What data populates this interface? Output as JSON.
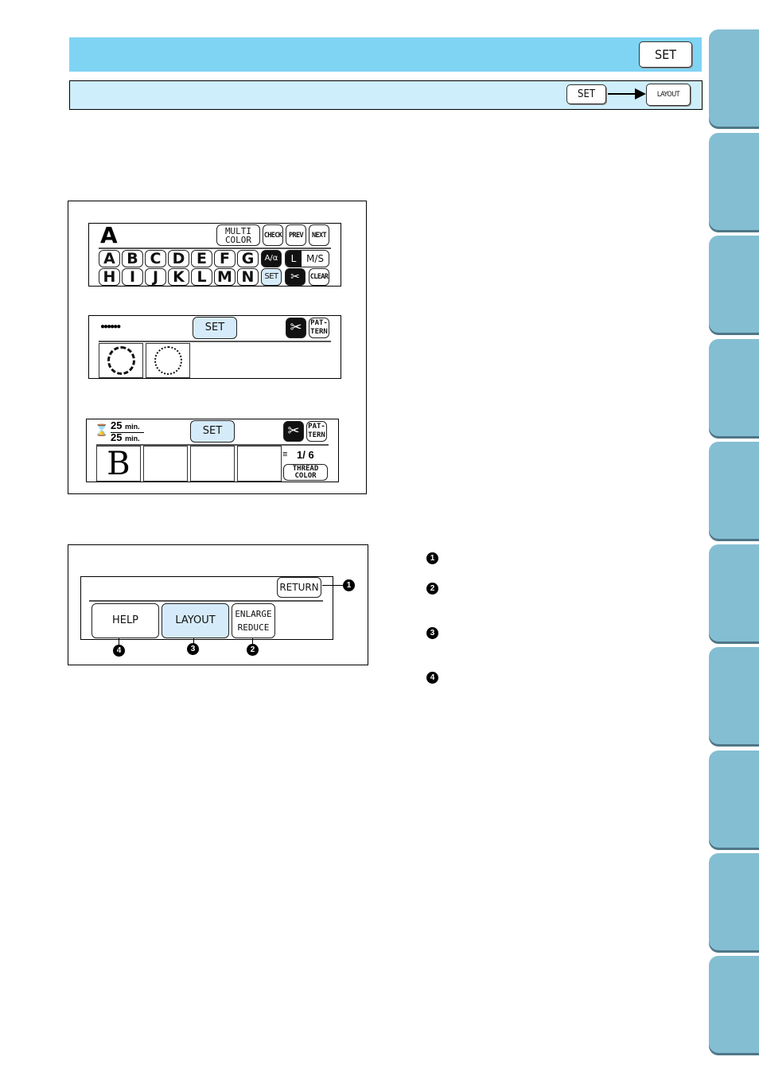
{
  "header": {
    "set_button": "SET"
  },
  "subheader": {
    "step1_button": "SET",
    "arrow_icon": "right-arrow-icon",
    "step2_button": "LAYOUT"
  },
  "figure1": {
    "screen1": {
      "selected_letter": "A",
      "multi_color": "MULTI\nCOLOR",
      "multi_color_line1": "MULTI",
      "multi_color_line2": "COLOR",
      "check": "CHECK",
      "prev": "PREV",
      "next": "NEXT",
      "letters_row1": [
        "A",
        "B",
        "C",
        "D",
        "E",
        "F",
        "G"
      ],
      "letters_row2": [
        "H",
        "I",
        "J",
        "K",
        "L",
        "M",
        "N"
      ],
      "case_toggle": "A/α",
      "size_l": "L",
      "size_ms": "M/S",
      "set": "SET",
      "clear": "CLEAR"
    },
    "screen2": {
      "preview_dots": "●●●●●●",
      "set": "SET",
      "pattern_line1": "PAT-",
      "pattern_line2": "TERN"
    },
    "screen3": {
      "time_top": "25",
      "time_top_unit": "min.",
      "time_bottom": "25",
      "time_bottom_unit": "min.",
      "set": "SET",
      "pattern_line1": "PAT-",
      "pattern_line2": "TERN",
      "preview_letter": "B",
      "thread_count": "1/ 6",
      "thread_color_line1": "THREAD",
      "thread_color_line2": "COLOR"
    }
  },
  "figure2": {
    "return": "RETURN",
    "help": "HELP",
    "layout": "LAYOUT",
    "enlarge": "ENLARGE",
    "reduce": "REDUCE",
    "callouts": [
      "1",
      "2",
      "3",
      "4"
    ]
  },
  "legend": {
    "items": [
      "1",
      "2",
      "3",
      "4"
    ]
  },
  "side_tabs": {
    "count": 10
  },
  "colors": {
    "header_blue": "#7fd4f4",
    "subheader_blue": "#cdeefa",
    "tab_blue": "#84bed2",
    "selected_button": "#d6ebfa"
  }
}
